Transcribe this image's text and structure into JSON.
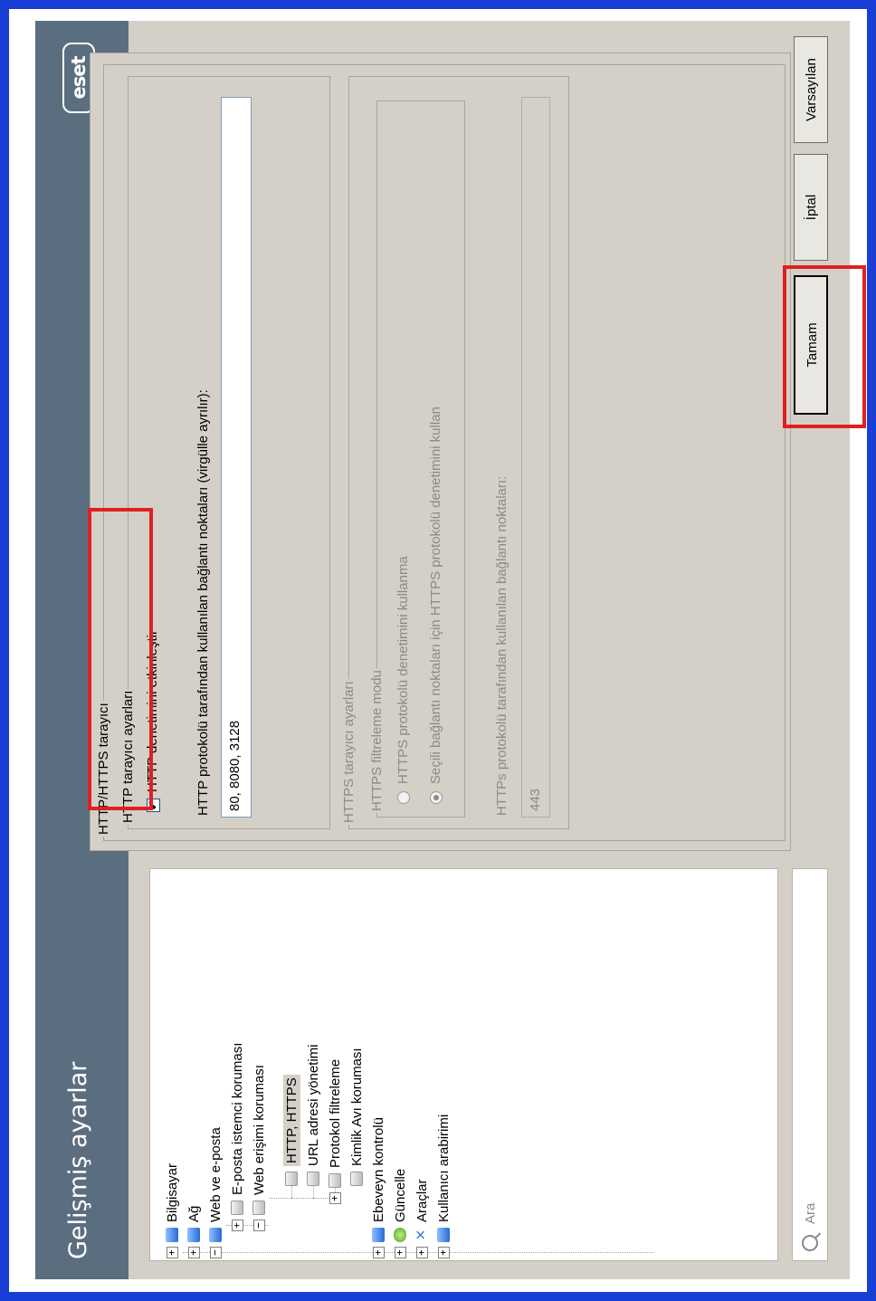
{
  "window": {
    "title": "Gelişmiş ayarlar",
    "logo": "eset"
  },
  "tree": {
    "items": [
      {
        "label": "Bilgisayar",
        "expander": "+",
        "icon": "computer-icon"
      },
      {
        "label": "Ağ",
        "expander": "+",
        "icon": "network-icon"
      },
      {
        "label": "Web ve e-posta",
        "expander": "−",
        "icon": "globe-icon"
      },
      {
        "label": "E-posta istemci koruması",
        "expander": "+",
        "icon": "module-icon"
      },
      {
        "label": "Web erişimi koruması",
        "expander": "−",
        "icon": "module-icon"
      },
      {
        "label": "HTTP, HTTPS",
        "expander": "",
        "icon": "module-icon",
        "selected": true
      },
      {
        "label": "URL adresi yönetimi",
        "expander": "",
        "icon": "module-icon"
      },
      {
        "label": "Protokol filtreleme",
        "expander": "+",
        "icon": "module-icon"
      },
      {
        "label": "Kimlik Avı koruması",
        "expander": "",
        "icon": "module-icon"
      },
      {
        "label": "Ebeveyn kontrolü",
        "expander": "+",
        "icon": "parental-icon"
      },
      {
        "label": "Güncelle",
        "expander": "+",
        "icon": "update-icon"
      },
      {
        "label": "Araçlar",
        "expander": "+",
        "icon": "tools-icon"
      },
      {
        "label": "Kullanıcı arabirimi",
        "expander": "+",
        "icon": "ui-icon"
      }
    ]
  },
  "search": {
    "placeholder": "Ara"
  },
  "panel": {
    "group_title": "HTTP/HTTPS tarayıcı",
    "http": {
      "legend": "HTTP tarayıcı ayarları",
      "enable_label": "HTTP denetimini etkinleştir",
      "enable_checked": true,
      "check_mark": "✔",
      "ports_label": "HTTP protokolü tarafından kullanılan bağlantı noktaları (virgülle ayrılır):",
      "ports_value": "80, 8080, 3128"
    },
    "https": {
      "legend": "HTTPS tarayıcı ayarları",
      "mode_legend": "HTTPS filtreleme modu",
      "option1": "HTTPS protokolü denetimini kullanma",
      "option2": "Seçili bağlantı noktaları için HTTPS protokolü denetimini kullan",
      "selected_option": 2,
      "ports_label": "HTTPs protokolü tarafından kullanılan bağlantı noktaları:",
      "ports_value": "443"
    }
  },
  "buttons": {
    "ok": "Tamam",
    "cancel": "İptal",
    "defaults": "Varsayılan"
  },
  "colors": {
    "highlight": "#e02020",
    "header": "#5b6e80",
    "border": "#1a3fd6"
  }
}
